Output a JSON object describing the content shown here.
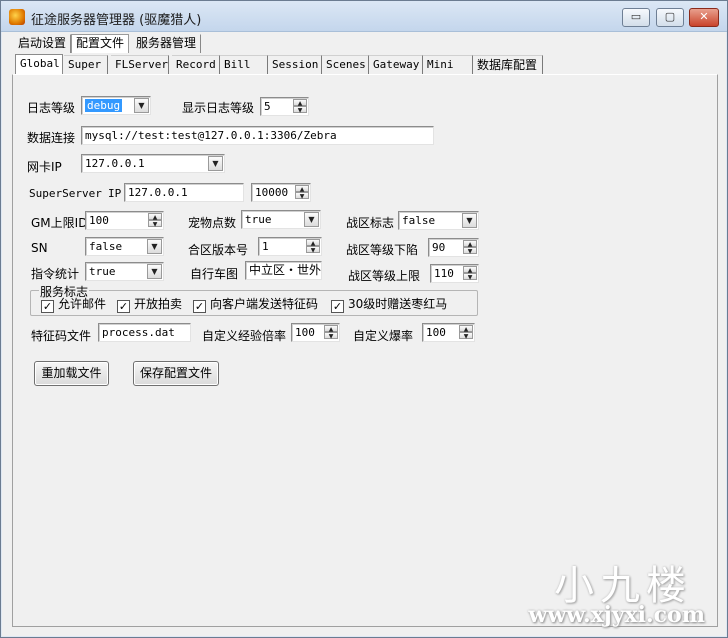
{
  "window": {
    "title": "征途服务器管理器 (驱魔猎人)",
    "buttons": {
      "minimize": "▭",
      "maximize": "▢",
      "close": "✕"
    }
  },
  "menu_tabs": [
    "启动设置",
    "配置文件",
    "服务器管理"
  ],
  "config_tabs": [
    "Global",
    "Super",
    "FLServer",
    "Record",
    "Bill",
    "Session",
    "Scenes",
    "Gateway",
    "Mini",
    "数据库配置"
  ],
  "form": {
    "log_level": {
      "label": "日志等级",
      "value": "debug"
    },
    "display_log_level": {
      "label": "显示日志等级",
      "value": "5"
    },
    "db_connection": {
      "label": "数据连接",
      "value": "mysql://test:test@127.0.0.1:3306/Zebra"
    },
    "nic_ip": {
      "label": "网卡IP",
      "value": "127.0.0.1"
    },
    "super_server": {
      "label": "SuperServer",
      "ip_label": "IP",
      "ip": "127.0.0.1",
      "port": "10000"
    },
    "gm_max_id": {
      "label": "GM上限ID",
      "value": "100"
    },
    "pet_points": {
      "label": "宠物点数",
      "value": "true"
    },
    "war_zone_flag": {
      "label": "战区标志",
      "value": "false"
    },
    "sn": {
      "label": "SN",
      "value": "false"
    },
    "merge_version": {
      "label": "合区版本号",
      "value": "1"
    },
    "war_zone_min_level": {
      "label": "战区等级下陷",
      "value": "90"
    },
    "cmd_stats": {
      "label": "指令统计",
      "value": "true"
    },
    "bike_map": {
      "label": "自行车图",
      "value": "中立区・世外"
    },
    "war_zone_max_level": {
      "label": "战区等级上限",
      "value": "110"
    },
    "service_flags": {
      "label": "服务标志",
      "items": [
        {
          "label": "允许邮件",
          "checked": true
        },
        {
          "label": "开放拍卖",
          "checked": true
        },
        {
          "label": "向客户端发送特征码",
          "checked": true
        },
        {
          "label": "30级时赠送枣红马",
          "checked": true
        }
      ]
    },
    "feature_file": {
      "label": "特征码文件",
      "value": "process.dat"
    },
    "exp_rate": {
      "label": "自定义经验倍率",
      "value": "100"
    },
    "drop_rate": {
      "label": "自定义爆率",
      "value": "100"
    }
  },
  "actions": {
    "reload": "重加载文件",
    "save": "保存配置文件"
  },
  "watermark": {
    "brand": "小九楼",
    "url": "www.xjyxi.com"
  }
}
